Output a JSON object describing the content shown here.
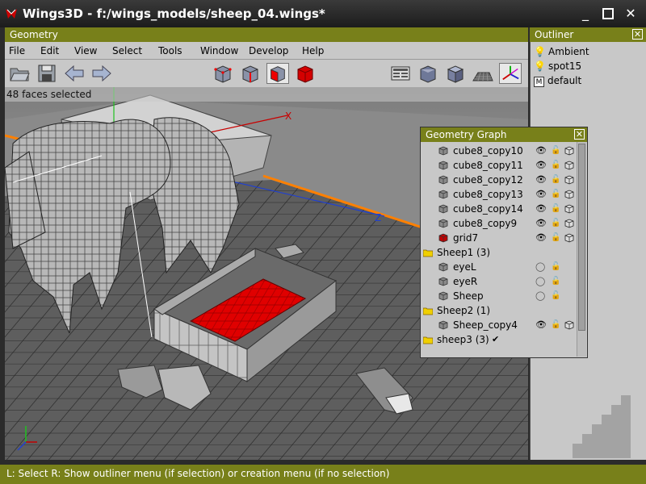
{
  "window": {
    "title": "Wings3D - f:/wings_models/sheep_04.wings*",
    "icons": [
      "wings3d-app-icon",
      "minimize-icon",
      "maximize-icon",
      "close-icon"
    ]
  },
  "geometry": {
    "header": "Geometry",
    "menu": [
      "File",
      "Edit",
      "View",
      "Select",
      "Tools",
      "Window",
      "Develop",
      "Help"
    ],
    "status": "48 faces selected",
    "toolbar_icons": [
      "open-folder-icon",
      "save-disk-icon",
      "undo-arrow-icon",
      "redo-arrow-icon",
      "vertex-mode-icon",
      "edge-mode-icon",
      "face-mode-icon",
      "body-mode-icon",
      "preferences-icon",
      "smooth-shading-icon",
      "flat-shading-icon",
      "ground-plane-icon",
      "axes-icon"
    ],
    "selected_mode": "face-mode-icon",
    "axis_labels": {
      "x": "X",
      "z": "Z"
    },
    "colors": {
      "selection": "#e00000",
      "axis_x": "#c80000",
      "axis_y": "#20c020",
      "axis_z": "#2040d0",
      "grid_border": "#ff8000"
    }
  },
  "outliner": {
    "header": "Outliner",
    "items": [
      {
        "label": "Ambient",
        "icon": "light-bulb-icon"
      },
      {
        "label": "spot15",
        "icon": "light-bulb-icon"
      },
      {
        "label": "default",
        "icon": "material-icon"
      }
    ]
  },
  "geometry_graph": {
    "header": "Geometry Graph",
    "rows": [
      {
        "label": "cube8_copy10",
        "kind": "object",
        "visible": true,
        "wire": true
      },
      {
        "label": "cube8_copy11",
        "kind": "object",
        "visible": true,
        "wire": true
      },
      {
        "label": "cube8_copy12",
        "kind": "object",
        "visible": true,
        "wire": true
      },
      {
        "label": "cube8_copy13",
        "kind": "object",
        "visible": true,
        "wire": true
      },
      {
        "label": "cube8_copy14",
        "kind": "object",
        "visible": true,
        "wire": true
      },
      {
        "label": "cube8_copy9",
        "kind": "object",
        "visible": true,
        "wire": true
      },
      {
        "label": "grid7",
        "kind": "object-selected",
        "visible": true,
        "wire": true
      },
      {
        "label": "Sheep1 (3)",
        "kind": "folder"
      },
      {
        "label": "eyeL",
        "kind": "object",
        "visible": false,
        "wire": false
      },
      {
        "label": "eyeR",
        "kind": "object",
        "visible": false,
        "wire": false
      },
      {
        "label": "Sheep",
        "kind": "object",
        "visible": false,
        "wire": false
      },
      {
        "label": "Sheep2 (1)",
        "kind": "folder"
      },
      {
        "label": "Sheep_copy4",
        "kind": "object",
        "visible": true,
        "wire": true
      },
      {
        "label": "sheep3 (3)",
        "kind": "folder-active",
        "mark": "✔"
      }
    ]
  },
  "statusbar": {
    "text": "L: Select   R: Show outliner menu (if selection) or creation menu (if no selection)"
  }
}
